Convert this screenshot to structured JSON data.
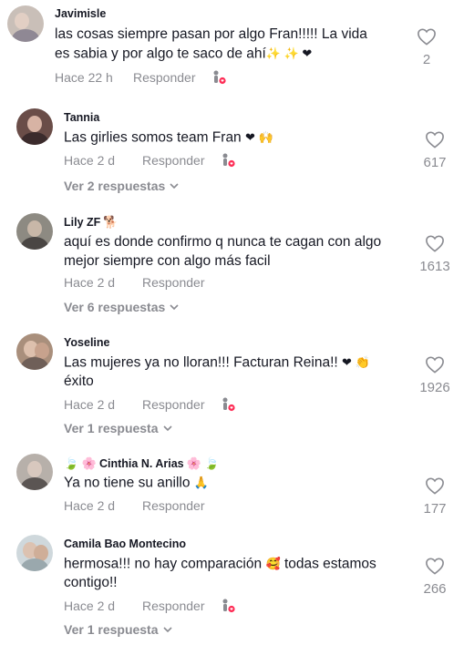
{
  "comments": [
    {
      "username": "Javimisle",
      "text_line1": "las cosas siempre pasan por algo Fran!!!!! La vida",
      "text_line2": "es sabia y por algo te saco de ahí",
      "emoji_suffix": "✨ ✨ ❤",
      "time": "Hace 22 h",
      "reply_label": "Responder",
      "likes": "2"
    },
    {
      "username": "Tannia",
      "text_line1": "Las girlies somos team Fran",
      "emoji_suffix": "❤ 🙌",
      "time": "Hace 2 d",
      "reply_label": "Responder",
      "likes": "617",
      "view_replies": "Ver 2 respuestas"
    },
    {
      "username": "Lily ZF",
      "username_emoji": "🐕",
      "text_line1": "aquí es donde confirmo q nunca te cagan con algo",
      "text_line2": "mejor siempre con algo más facil",
      "time": "Hace 2 d",
      "reply_label": "Responder",
      "likes": "1613",
      "view_replies": "Ver 6 respuestas"
    },
    {
      "username": "Yoseline",
      "text_line1": "Las mujeres ya no lloran!!! Facturan Reina!!",
      "emoji_suffix": "❤ 👏",
      "text_line2": "éxito",
      "time": "Hace 2 d",
      "reply_label": "Responder",
      "likes": "1926",
      "view_replies": "Ver 1 respuesta"
    },
    {
      "username_prefix": "🍃 🌸",
      "username": "Cinthia N. Arias",
      "username_suffix": "🌸 🍃",
      "text_line1": "Ya no tiene su anillo",
      "emoji_suffix": "🙏",
      "time": "Hace 2 d",
      "reply_label": "Responder",
      "likes": "177"
    },
    {
      "username": "Camila Bao Montecino",
      "text_line1": "hermosa!!! no hay comparación",
      "emoji_mid": "🥰",
      "text_line1_end": "todas estamos",
      "text_line2": "contigo!!",
      "time": "Hace 2 d",
      "reply_label": "Responder",
      "likes": "266",
      "view_replies": "Ver 1 respuesta"
    }
  ],
  "colors": {
    "primary_text": "#161823",
    "secondary_text": "#8a8b91",
    "accent_pink": "#fe2c55",
    "heart_red": "#e8242f"
  },
  "icons": {
    "like": "heart-outline-icon",
    "creator_liked": "creator-liked-icon",
    "expand": "chevron-down-icon"
  }
}
